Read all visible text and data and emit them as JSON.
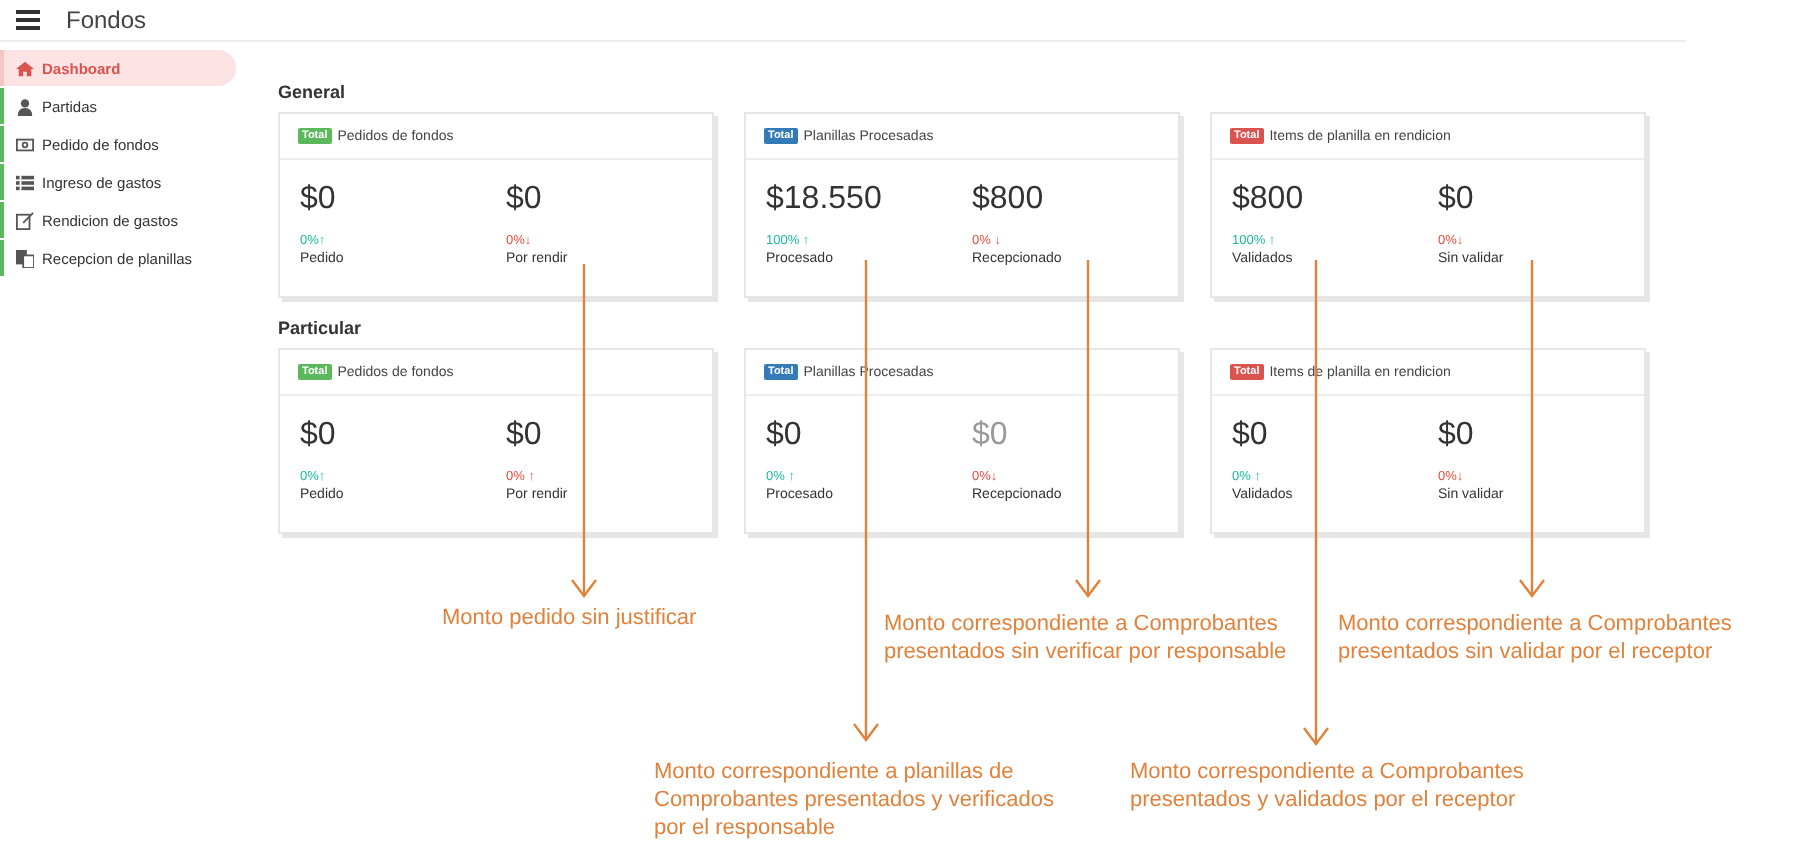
{
  "header": {
    "title": "Fondos"
  },
  "sidebar": {
    "items": [
      {
        "label": "Dashboard",
        "selected": true
      },
      {
        "label": "Partidas",
        "selected": false
      },
      {
        "label": "Pedido de fondos",
        "selected": false
      },
      {
        "label": "Ingreso de gastos",
        "selected": false
      },
      {
        "label": "Rendicion de gastos",
        "selected": false
      },
      {
        "label": "Recepcion de planillas",
        "selected": false
      }
    ]
  },
  "sections": [
    {
      "title": "General",
      "cards": [
        {
          "badge": "Total",
          "color": "#5cb85c",
          "title": "Pedidos de fondos",
          "stats": [
            {
              "value": "$0",
              "muted": false,
              "trend": "0%↑",
              "color": "#1abb9c",
              "label": "Pedido"
            },
            {
              "value": "$0",
              "muted": false,
              "trend": "0%↓",
              "color": "#e74c3c",
              "label": "Por rendir"
            }
          ]
        },
        {
          "badge": "Total",
          "color": "#337ab7",
          "title": "Planillas Procesadas",
          "stats": [
            {
              "value": "$18.550",
              "muted": false,
              "trend": "100% ↑",
              "color": "#1abb9c",
              "label": "Procesado"
            },
            {
              "value": "$800",
              "muted": false,
              "trend": "0% ↓",
              "color": "#e74c3c",
              "label": "Recepcionado"
            }
          ]
        },
        {
          "badge": "Total",
          "color": "#d9534f",
          "title": "Items de planilla en rendicion",
          "stats": [
            {
              "value": "$800",
              "muted": false,
              "trend": "100% ↑",
              "color": "#1abb9c",
              "label": "Validados"
            },
            {
              "value": "$0",
              "muted": false,
              "trend": "0%↓",
              "color": "#e74c3c",
              "label": "Sin validar"
            }
          ]
        }
      ]
    },
    {
      "title": "Particular",
      "cards": [
        {
          "badge": "Total",
          "color": "#5cb85c",
          "title": "Pedidos de fondos",
          "stats": [
            {
              "value": "$0",
              "muted": false,
              "trend": "0%↑",
              "color": "#1abb9c",
              "label": "Pedido"
            },
            {
              "value": "$0",
              "muted": false,
              "trend": "0% ↑",
              "color": "#e74c3c",
              "label": "Por rendir"
            }
          ]
        },
        {
          "badge": "Total",
          "color": "#337ab7",
          "title": "Planillas Procesadas",
          "stats": [
            {
              "value": "$0",
              "muted": false,
              "trend": "0% ↑",
              "color": "#1abb9c",
              "label": "Procesado"
            },
            {
              "value": "$0",
              "muted": true,
              "trend": "0%↓",
              "color": "#e74c3c",
              "label": "Recepcionado"
            }
          ]
        },
        {
          "badge": "Total",
          "color": "#d9534f",
          "title": "Items de planilla en rendicion",
          "stats": [
            {
              "value": "$0",
              "muted": false,
              "trend": "0% ↑",
              "color": "#1abb9c",
              "label": "Validados"
            },
            {
              "value": "$0",
              "muted": false,
              "trend": "0%↓",
              "color": "#e74c3c",
              "label": "Sin validar"
            }
          ]
        }
      ]
    }
  ],
  "annotations": [
    {
      "text": "Monto pedido sin justificar"
    },
    {
      "text": "Monto correspondiente a planillas de Comprobantes presentados y verificados por el responsable"
    },
    {
      "text": "Monto correspondiente a Comprobantes presentados sin verificar por responsable"
    },
    {
      "text": "Monto correspondiente a Comprobantes presentados y validados por el receptor"
    },
    {
      "text": "Monto correspondiente a Comprobantes presentados sin validar por el receptor"
    }
  ]
}
